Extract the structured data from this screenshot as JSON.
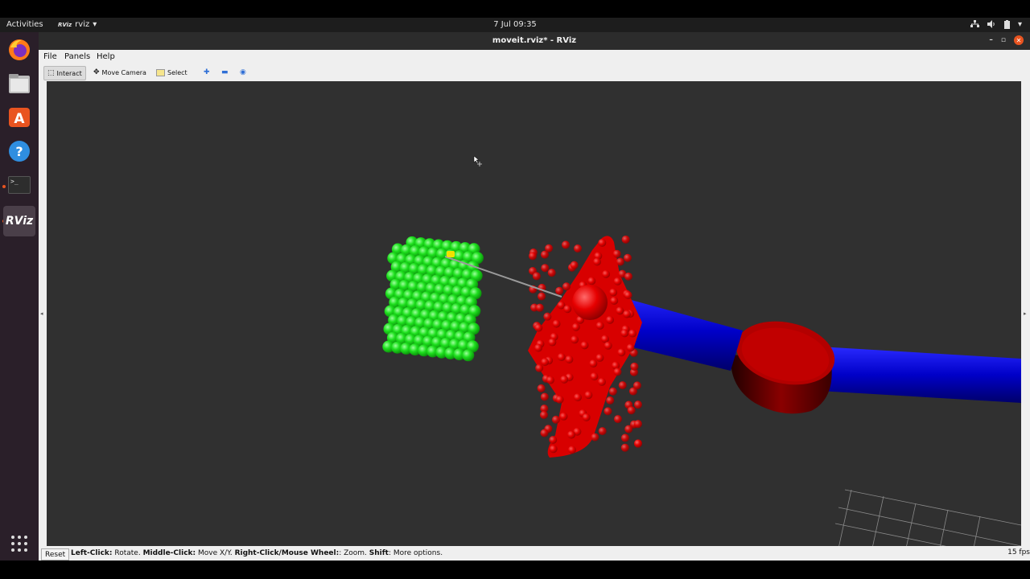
{
  "topbar": {
    "activities": "Activities",
    "app_label": "rviz",
    "app_icon_text": "RViz",
    "clock": "7 Jul  09:35"
  },
  "dock": {
    "items": [
      "firefox-icon",
      "files-icon",
      "software-center-icon",
      "help-icon",
      "terminal-icon",
      "rviz-icon"
    ],
    "rviz_text": "RViz",
    "terminal_text": ">_"
  },
  "window": {
    "title": "moveit.rviz* - RViz",
    "menu": {
      "file": "File",
      "panels": "Panels",
      "help": "Help"
    },
    "toolbar": {
      "interact": "Interact",
      "move_camera": "Move Camera",
      "select": "Select"
    },
    "status": {
      "reset": "Reset",
      "left_click": "Left-Click:",
      "left_action": " Rotate. ",
      "middle_click": "Middle-Click:",
      "middle_action": " Move X/Y. ",
      "right_click": "Right-Click/Mouse Wheel:",
      "right_action": ": Zoom. ",
      "shift": "Shift",
      "shift_action": ": More options.",
      "fps": "15 fps"
    }
  },
  "scene": {
    "background": "#303030",
    "colors": {
      "green_spheres": "#1ee01e",
      "red_gripper": "#e60000",
      "blue_link": "#0000d0",
      "red_joint": "#c40000",
      "highlight": "#f0e000"
    },
    "objects": [
      "green-sphere-cluster",
      "red-gripper",
      "blue-arm-link",
      "red-joint",
      "blue-arm-link-2",
      "grid"
    ]
  }
}
